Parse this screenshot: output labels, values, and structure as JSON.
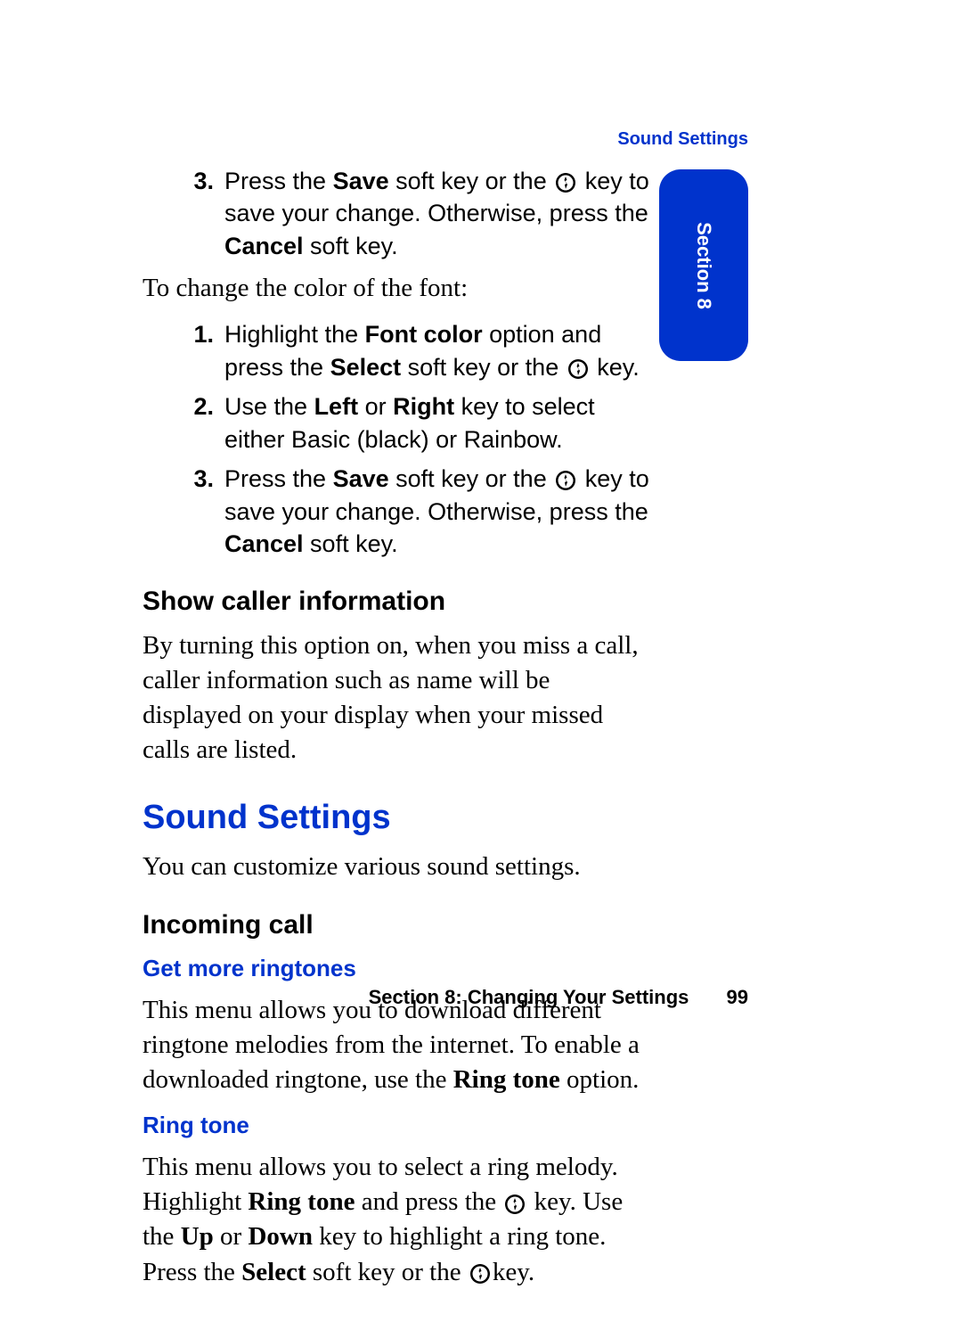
{
  "header": {
    "running_title": "Sound Settings"
  },
  "side_tab": {
    "label": "Section 8"
  },
  "first_list": {
    "item3": {
      "num": "3.",
      "t1": "Press the ",
      "b1": "Save",
      "t2": " soft key or the ",
      "t3": " key to save your change. Otherwise, press the ",
      "b2": "Cancel",
      "t4": " soft key."
    }
  },
  "font_color_intro": "To change the color of the font:",
  "font_list": {
    "item1": {
      "num": "1.",
      "t1": "Highlight the ",
      "b1": "Font color",
      "t2": " option and press the ",
      "b2": "Select",
      "t3": " soft key or the ",
      "t4": " key."
    },
    "item2": {
      "num": "2.",
      "t1": "Use the ",
      "b1": "Left",
      "t2": " or ",
      "b2": "Right",
      "t3": " key to select either Basic (black) or Rainbow."
    },
    "item3": {
      "num": "3.",
      "t1": "Press the ",
      "b1": "Save",
      "t2": " soft key or the ",
      "t3": " key to save your change. Otherwise, press the ",
      "b2": "Cancel",
      "t4": " soft key."
    }
  },
  "show_caller": {
    "heading": "Show caller information",
    "para": "By turning this option on, when you miss a call, caller information such as name will be displayed on your display when your missed calls are listed."
  },
  "sound_settings": {
    "heading": "Sound Settings",
    "intro": "You can customize various sound settings."
  },
  "incoming_call": {
    "heading": "Incoming call"
  },
  "get_more": {
    "heading": "Get more ringtones",
    "t1": "This menu allows you to download different ringtone melodies from the internet. To enable a downloaded ringtone, use the ",
    "b1": "Ring tone",
    "t2": " option."
  },
  "ring_tone": {
    "heading": "Ring tone",
    "t1": "This menu allows you to select a ring melody. Highlight ",
    "b1": "Ring tone",
    "t2": " and press the ",
    "t3": " key. Use the ",
    "b2": "Up",
    "t4": " or ",
    "b3": "Down",
    "t5": " key to highlight a ring tone. Press the ",
    "b4": "Select",
    "t6": " soft key or the ",
    "t7": "key."
  },
  "footer": {
    "section_label": "Section 8: Changing Your Settings",
    "page_number": "99"
  }
}
